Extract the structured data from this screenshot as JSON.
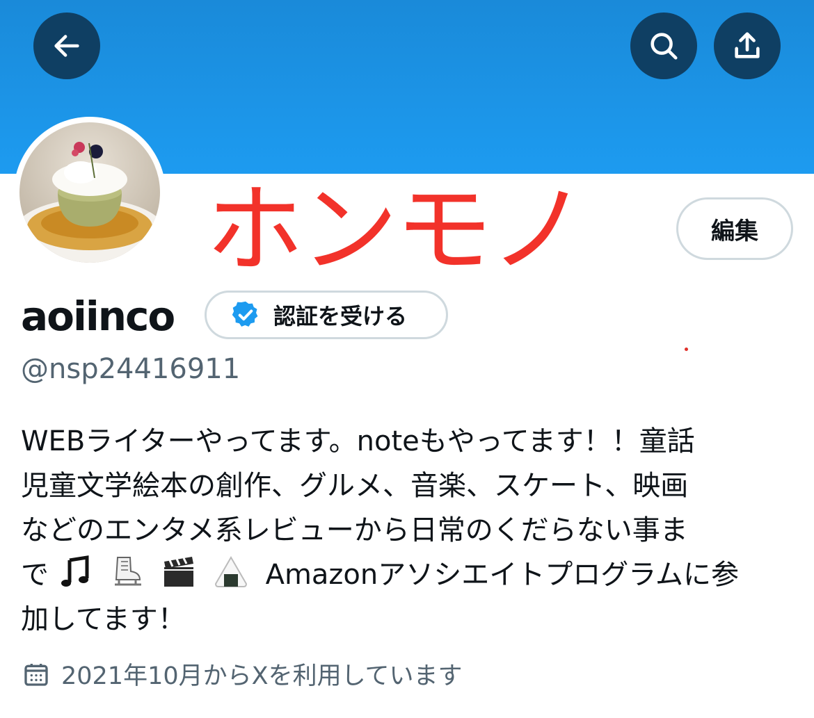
{
  "header": {
    "back_icon": "arrow-left-icon",
    "search_icon": "search-icon",
    "share_icon": "share-upload-icon",
    "banner_color": "#1d9bf0",
    "button_color": "#0f3f63"
  },
  "annotation": {
    "text": "ホンモノ",
    "color": "#f2322a"
  },
  "profile": {
    "edit_label": "編集",
    "display_name": "aoiinco",
    "verify_label": "認証を受ける",
    "verify_icon": "verified-badge-icon",
    "handle": "@nsp24416911",
    "bio_line_1": "WEBライターやってます。noteもやってます！！童話",
    "bio_line_2": "児童文学絵本の創作、グルメ、音楽、スケート、映画",
    "bio_line_3": "などのエンタメ系レビューから日常のくだらない事ま",
    "bio_line_4a": "で",
    "bio_line_4b": "Amazonアソシエイトプログラムに参",
    "bio_line_5": "加してます！",
    "bio_emojis": [
      "music-notes-icon",
      "ice-skate-icon",
      "clapper-board-icon",
      "rice-ball-icon"
    ],
    "joined_icon": "calendar-icon",
    "joined_text": "2021年10月からXを利用しています"
  }
}
